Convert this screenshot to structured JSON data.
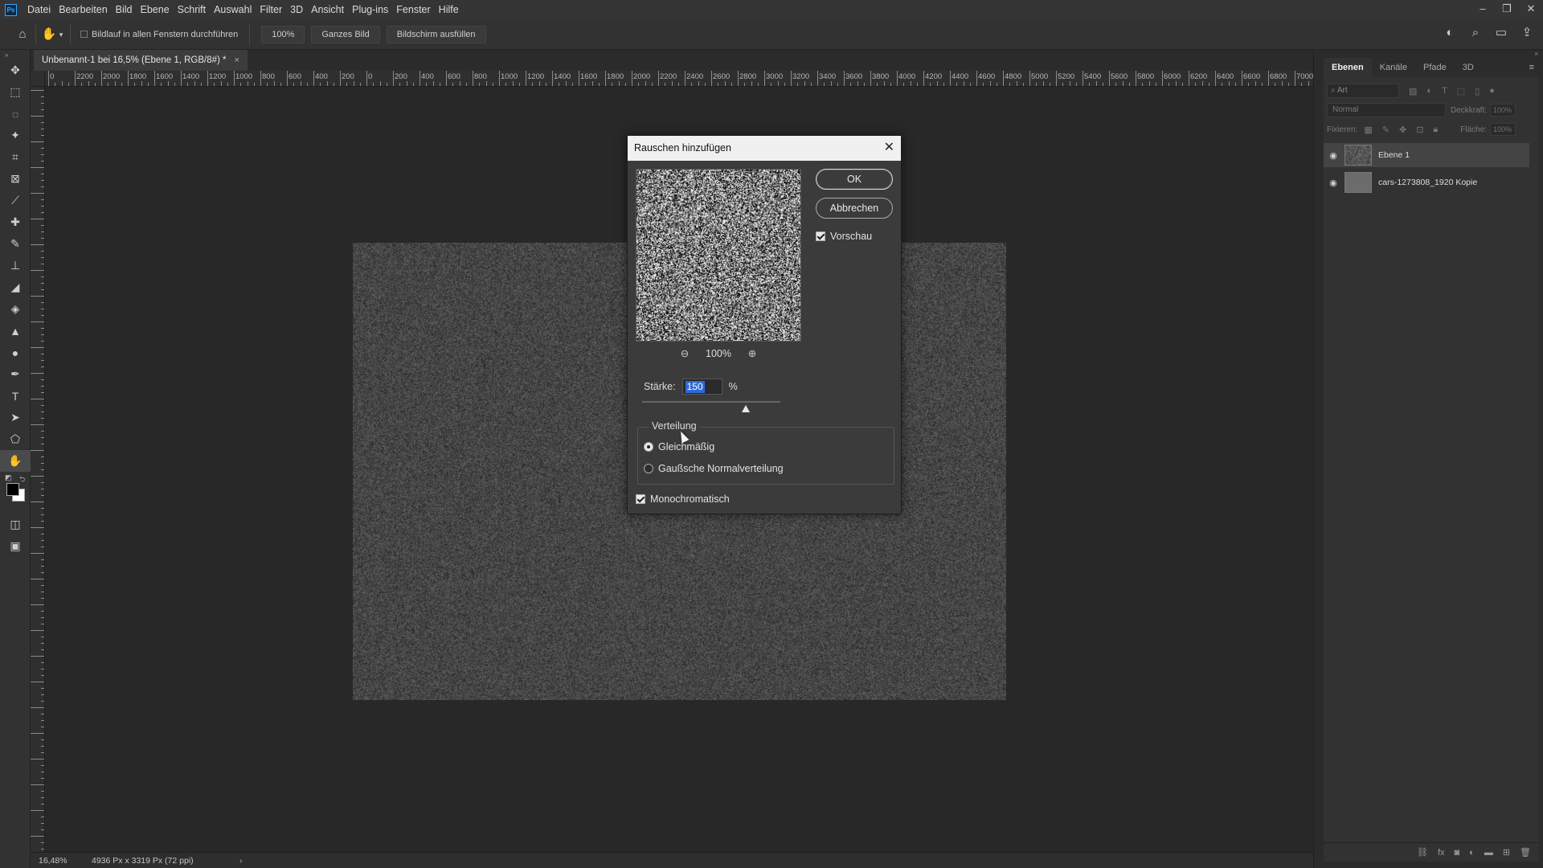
{
  "app": {
    "name": "Ps"
  },
  "menubar": {
    "items": [
      "Datei",
      "Bearbeiten",
      "Bild",
      "Ebene",
      "Schrift",
      "Auswahl",
      "Filter",
      "3D",
      "Ansicht",
      "Plug-ins",
      "Fenster",
      "Hilfe"
    ],
    "window_controls": [
      "–",
      "❐",
      "✕"
    ]
  },
  "optionsbar": {
    "scroll_all_windows": "Bildlauf in allen Fenstern durchführen",
    "zoom_100": "100%",
    "fit_screen": "Ganzes Bild",
    "fill_screen": "Bildschirm ausfüllen"
  },
  "document": {
    "tab_title": "Unbenannt-1 bei 16,5% (Ebene 1, RGB/8#) *",
    "close": "×"
  },
  "ruler": {
    "h_labels": [
      "0",
      "2200",
      "2000",
      "1800",
      "1600",
      "1400",
      "1200",
      "1000",
      "800",
      "600",
      "400",
      "200",
      "0",
      "200",
      "400",
      "600",
      "800",
      "1000",
      "1200",
      "1400",
      "1600",
      "1800",
      "2000",
      "2200",
      "2400",
      "2600",
      "2800",
      "3000",
      "3200",
      "3400",
      "3600",
      "3800",
      "4000",
      "4200",
      "4400",
      "4600",
      "4800",
      "5000",
      "5200",
      "5400",
      "5600",
      "5800",
      "6000",
      "6200",
      "6400",
      "6600",
      "6800",
      "7000",
      "7"
    ]
  },
  "statusbar": {
    "zoom": "16,48%",
    "doc_info": "4936 Px x 3319 Px (72 ppi)",
    "chevron": "›"
  },
  "panels": {
    "tabs": [
      "Ebenen",
      "Kanäle",
      "Pfade",
      "3D"
    ],
    "active_tab": "Ebenen",
    "search_placeholder": "Art",
    "blend_mode": "Normal",
    "opacity_label": "Deckkraft:",
    "opacity_value": "100%",
    "lock_label": "Fixieren:",
    "fill_label": "Fläche:",
    "fill_value": "100%",
    "layers": [
      {
        "name": "Ebene 1",
        "selected": true
      },
      {
        "name": "cars-1273808_1920 Kopie",
        "selected": false
      }
    ]
  },
  "dialog": {
    "title": "Rauschen hinzufügen",
    "close": "✕",
    "ok": "OK",
    "cancel": "Abbrechen",
    "preview_label": "Vorschau",
    "preview_checked": true,
    "zoom_value": "100%",
    "amount_label": "Stärke:",
    "amount_value": "150",
    "amount_unit": "%",
    "amount_fraction": 0.75,
    "distribution_legend": "Verteilung",
    "distribution_options": [
      "Gleichmäßig",
      "Gaußsche Normalverteilung"
    ],
    "distribution_selected": "Gleichmäßig",
    "monochrome_label": "Monochromatisch",
    "monochrome_checked": true
  }
}
